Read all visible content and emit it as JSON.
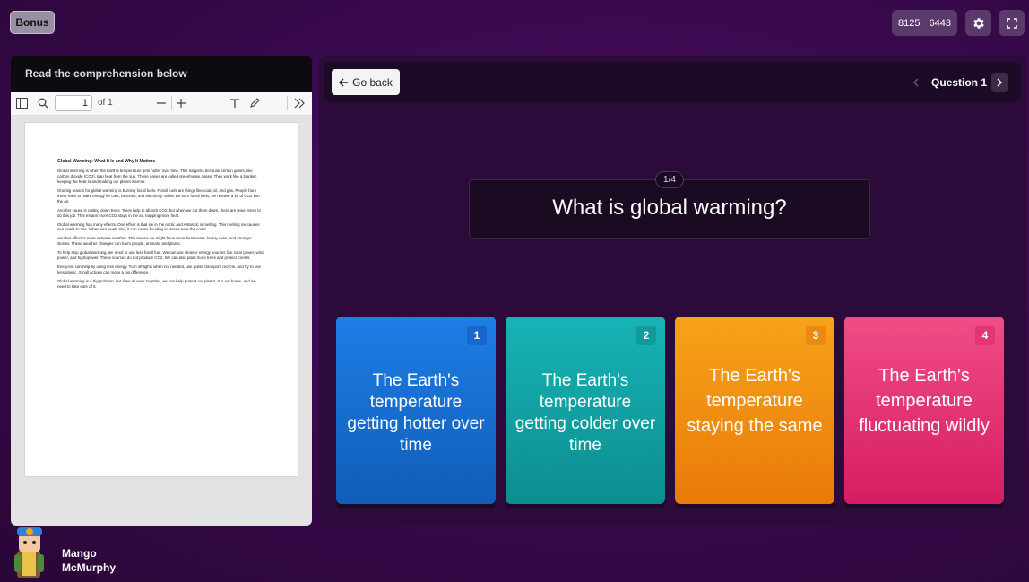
{
  "header": {
    "bonus_label": "Bonus",
    "code_part1": "8125",
    "code_part2": "6443"
  },
  "reader": {
    "title": "Read the comprehension below",
    "toolbar": {
      "page_value": "1",
      "page_total": "of 1"
    },
    "document": {
      "heading": "Global Warming: What It Is and Why It Matters",
      "paragraphs": [
        "Global warming is when the Earth's temperature gets hotter over time. This happens because certain gases, like carbon dioxide (CO2), trap heat from the sun. These gases are called greenhouse gases. They work like a blanket, keeping the heat in and making our planet warmer.",
        "One big reason for global warming is burning fossil fuels. Fossil fuels are things like coal, oil, and gas. People burn these fuels to make energy for cars, factories, and electricity. When we burn fossil fuels, we release a lot of CO2 into the air.",
        "Another cause is cutting down trees. Trees help to absorb CO2, but when we cut them down, there are fewer trees to do this job. This means more CO2 stays in the air, trapping more heat.",
        "Global warming has many effects. One effect is that ice in the Arctic and Antarctic is melting. This melting ice causes sea levels to rise. When sea levels rise, it can cause flooding in places near the coast.",
        "Another effect is more extreme weather. This means we might have more heatwaves, heavy rains, and stronger storms. These weather changes can harm people, animals, and plants.",
        "To help stop global warming, we need to use less fossil fuel. We can use cleaner energy sources like solar power, wind power, and hydropower. These sources do not produce CO2. We can also plant more trees and protect forests.",
        "Everyone can help by using less energy. Turn off lights when not needed, use public transport, recycle, and try to use less plastic. Small actions can make a big difference.",
        "Global warming is a big problem, but if we all work together, we can help protect our planet. It is our home, and we need to take care of it."
      ]
    }
  },
  "quiz": {
    "go_back_label": "Go back",
    "question_label": "Question 1",
    "counter": "1/4",
    "question": "What is global warming?",
    "answers": [
      {
        "num": "1",
        "text": "The Earth's temperature getting hotter over time",
        "color": "#1e7ee6"
      },
      {
        "num": "2",
        "text": "The Earth's temperature getting colder over time",
        "color": "#17b3b6"
      },
      {
        "num": "3",
        "text": "The Earth's temperature staying the same",
        "color": "#f7a21a"
      },
      {
        "num": "4",
        "text": "The Earth's temperature fluctuating wildly",
        "color": "#f04d86"
      }
    ]
  },
  "player": {
    "first_name": "Mango",
    "last_name": "McMurphy"
  },
  "icons": {
    "settings": "gear-icon",
    "fullscreen": "fullscreen-icon",
    "back": "arrow-left-icon"
  }
}
